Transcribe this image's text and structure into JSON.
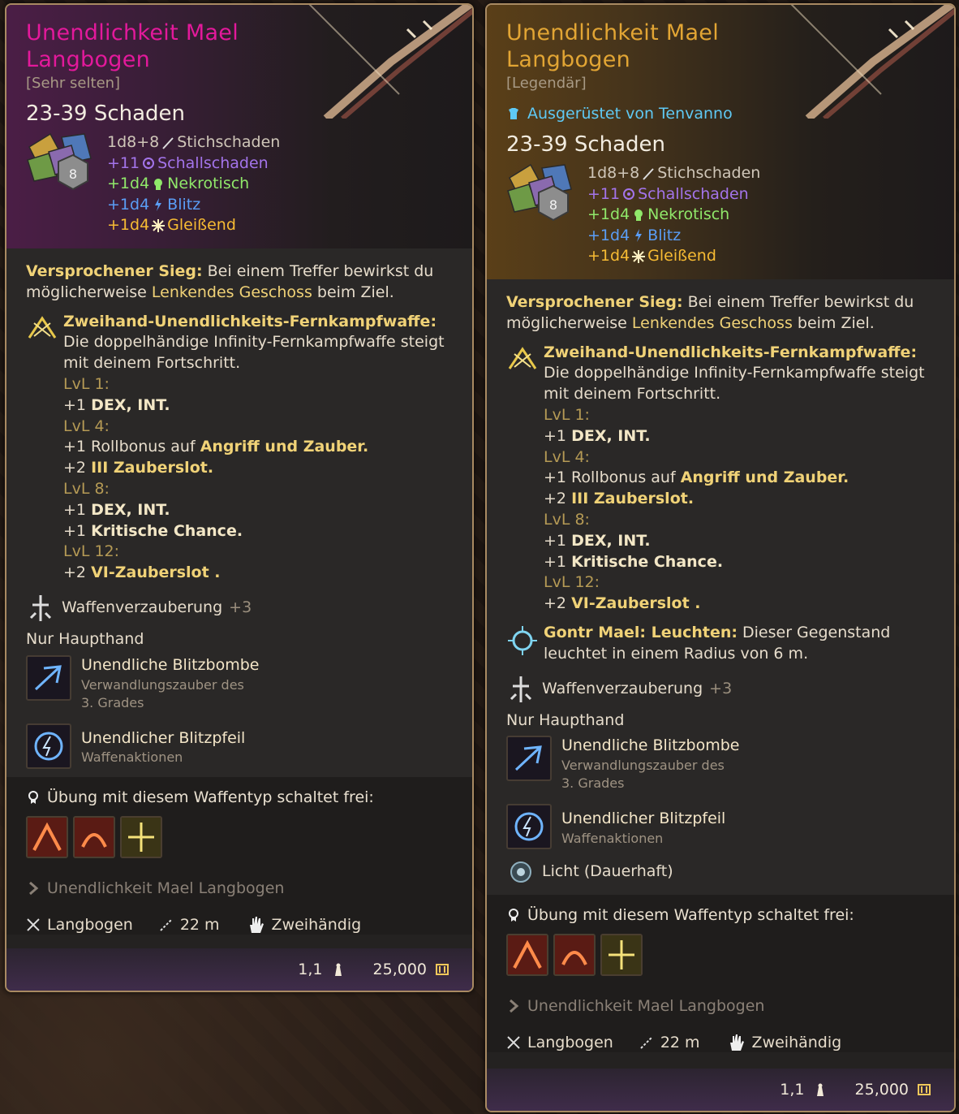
{
  "card1": {
    "name": "Unendlichkeit Mael Langbogen",
    "rarity": "[Sehr selten]",
    "damage": "23-39 Schaden",
    "dice_number": "8",
    "damage_lines": [
      {
        "amount": "1d8+8",
        "type": "Stichschaden",
        "color": "#cfc6b8",
        "icon": "pierce-icon"
      },
      {
        "amount": "+11",
        "type": "Schallschaden",
        "color": "#a374ea",
        "icon": "thunder-icon"
      },
      {
        "amount": "+1d4",
        "type": "Nekrotisch",
        "color": "#90e86a",
        "icon": "necrotic-icon"
      },
      {
        "amount": "+1d4",
        "type": "Blitz",
        "color": "#5a9df5",
        "icon": "lightning-icon"
      },
      {
        "amount": "+1d4",
        "type": "Gleißend",
        "color": "#f7bb33",
        "icon": "radiant-icon"
      }
    ],
    "sieg_title": "Versprochener Sieg:",
    "sieg_text1": " Bei einem Treffer bewirkst du möglicherweise ",
    "sieg_link": "Lenkendes Geschoss",
    "sieg_text2": " beim Ziel.",
    "infinity_title": "Zweihand-Unendlichkeits-Fernkampfwaffe:",
    "infinity_text": " Die doppelhändige Infinity-Fernkampfwaffe steigt mit deinem Fortschritt.",
    "lvl1": "LvL 1:",
    "lvl1_line_a": "+1 ",
    "lvl1_line_b": "DEX, INT.",
    "lvl4": "LvL 4:",
    "lvl4_line1_a": "+1 Rollbonus auf ",
    "lvl4_line1_b": "Angriff und Zauber.",
    "lvl4_line2_a": "+2 ",
    "lvl4_line2_b": "III Zauberslot.",
    "lvl8": "LvL 8:",
    "lvl8_line1_a": "+1 ",
    "lvl8_line1_b": "DEX, INT.",
    "lvl8_line2_a": "+1  ",
    "lvl8_line2_b": "Kritische Chance.",
    "lvl12": "LvL 12:",
    "lvl12_line_a": "+2 ",
    "lvl12_line_b": "VI-Zauberslot .",
    "ench": "Waffenverzauberung",
    "ench_plus": "+3",
    "mainhand": "Nur Haupthand",
    "spell1_name": "Unendliche Blitzbombe",
    "spell1_desc1": "Verwandlungszauber des",
    "spell1_desc2": "3. Grades",
    "spell2_name": "Unendlicher Blitzpfeil",
    "spell2_desc": "Waffenaktionen",
    "unlock": "Übung mit diesem Waffentyp schaltet frei:",
    "enchant_name": "Unendlichkeit Mael Langbogen",
    "prop_type": "Langbogen",
    "prop_range": "22 m",
    "prop_hand": "Zweihändig",
    "weight": "1,1",
    "value": "25,000"
  },
  "card2": {
    "name": "Unendlichkeit Mael Langbogen",
    "rarity": "[Legendär]",
    "equipped": "Ausgerüstet von Tenvanno",
    "damage": "23-39 Schaden",
    "dice_number": "8",
    "damage_lines": [
      {
        "amount": "1d8+8",
        "type": "Stichschaden",
        "color": "#cfc6b8",
        "icon": "pierce-icon"
      },
      {
        "amount": "+11",
        "type": "Schallschaden",
        "color": "#a374ea",
        "icon": "thunder-icon"
      },
      {
        "amount": "+1d4",
        "type": "Nekrotisch",
        "color": "#90e86a",
        "icon": "necrotic-icon"
      },
      {
        "amount": "+1d4",
        "type": "Blitz",
        "color": "#5a9df5",
        "icon": "lightning-icon"
      },
      {
        "amount": "+1d4",
        "type": "Gleißend",
        "color": "#f7bb33",
        "icon": "radiant-icon"
      }
    ],
    "sieg_title": "Versprochener Sieg:",
    "sieg_text1": " Bei einem Treffer bewirkst du möglicherweise ",
    "sieg_link": "Lenkendes Geschoss",
    "sieg_text2": " beim Ziel.",
    "infinity_title": "Zweihand-Unendlichkeits-Fernkampfwaffe:",
    "infinity_text": " Die doppelhändige Infinity-Fernkampfwaffe steigt mit deinem Fortschritt.",
    "lvl1": "LvL 1:",
    "lvl1_line_a": "+1 ",
    "lvl1_line_b": "DEX, INT.",
    "lvl4": "LvL 4:",
    "lvl4_line1_a": "+1 Rollbonus auf ",
    "lvl4_line1_b": "Angriff und Zauber.",
    "lvl4_line2_a": "+2 ",
    "lvl4_line2_b": "III Zauberslot.",
    "lvl8": "LvL 8:",
    "lvl8_line1_a": "+1 ",
    "lvl8_line1_b": "DEX, INT.",
    "lvl8_line2_a": "+1  ",
    "lvl8_line2_b": "Kritische Chance.",
    "lvl12": "LvL 12:",
    "lvl12_line_a": "+2 ",
    "lvl12_line_b": "VI-Zauberslot .",
    "light_title": "Gontr Mael: Leuchten:",
    "light_text": " Dieser Gegenstand leuchtet in einem Radius von 6 m.",
    "ench": "Waffenverzauberung",
    "ench_plus": "+3",
    "mainhand": "Nur Haupthand",
    "spell1_name": "Unendliche Blitzbombe",
    "spell1_desc1": "Verwandlungszauber des",
    "spell1_desc2": "3. Grades",
    "spell2_name": "Unendlicher Blitzpfeil",
    "spell2_desc": "Waffenaktionen",
    "light_status": "Licht  (Dauerhaft)",
    "unlock": "Übung mit diesem Waffentyp schaltet frei:",
    "enchant_name": "Unendlichkeit Mael Langbogen",
    "prop_type": "Langbogen",
    "prop_range": "22 m",
    "prop_hand": "Zweihändig",
    "weight": "1,1",
    "value": "25,000"
  }
}
